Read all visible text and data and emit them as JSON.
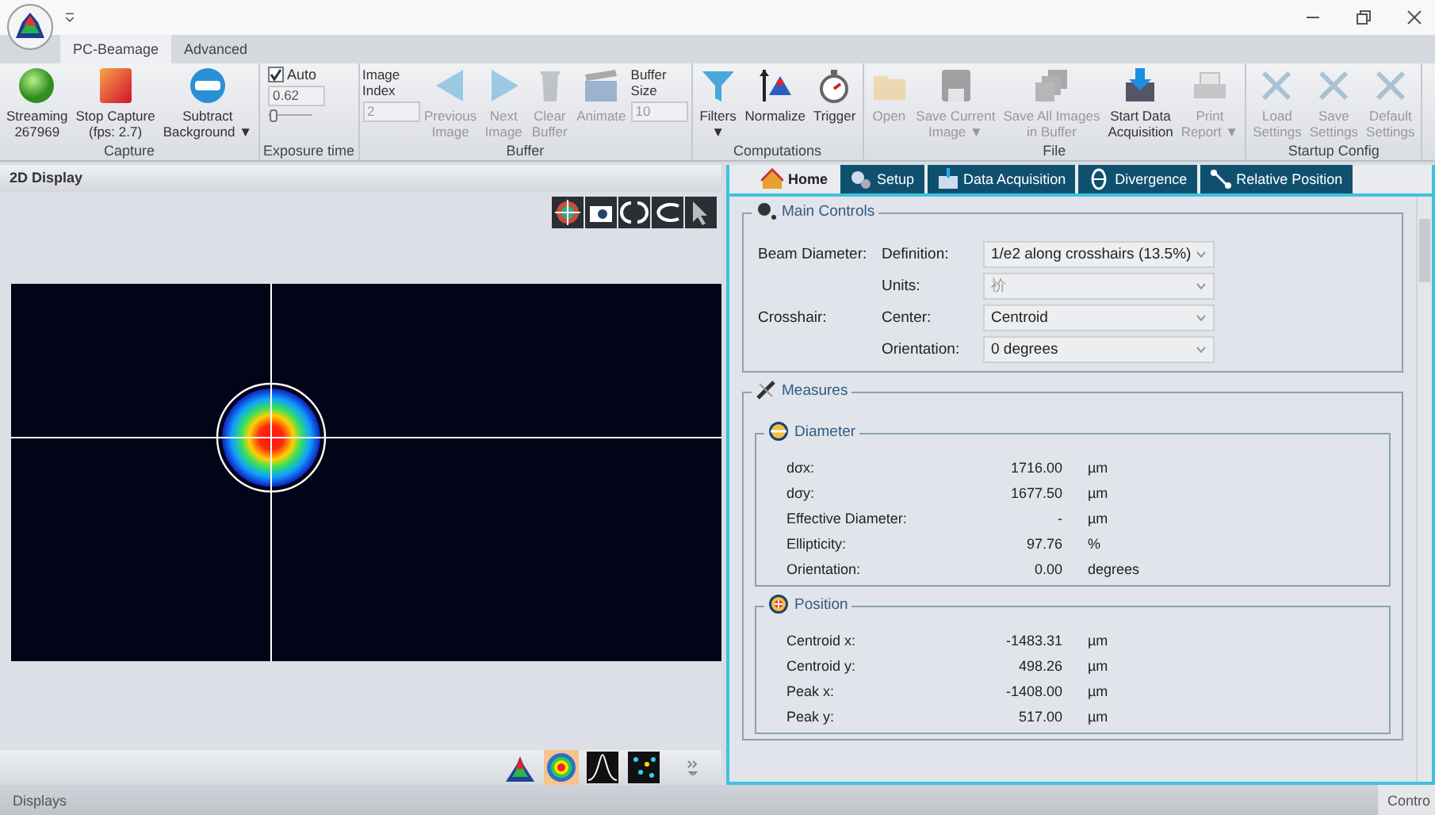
{
  "window": {
    "tabs": [
      {
        "label": "PC-Beamage",
        "selected": true
      },
      {
        "label": "Advanced",
        "selected": false
      }
    ]
  },
  "ribbon": {
    "groups": [
      {
        "label": "Capture",
        "items": [
          {
            "kind": "button",
            "label": "Streaming\n267969",
            "disabled": false
          },
          {
            "kind": "button",
            "label": "Stop Capture\n(fps: 2.7)",
            "disabled": false
          },
          {
            "kind": "button",
            "label": "Subtract\nBackground ▼",
            "disabled": false
          }
        ]
      },
      {
        "label": "Exposure time",
        "items": [
          {
            "kind": "checkbox",
            "label": "Auto",
            "checked": true
          },
          {
            "kind": "field",
            "value": "0.62",
            "disabled": false
          },
          {
            "kind": "slider",
            "level": 0.1
          }
        ]
      },
      {
        "label": "Buffer",
        "items": [
          {
            "kind": "labeled-field",
            "label": "Image\nIndex",
            "value": "2",
            "disabled": true
          },
          {
            "kind": "button",
            "label": "Previous\nImage",
            "disabled": true
          },
          {
            "kind": "button",
            "label": "Next\nImage",
            "disabled": true
          },
          {
            "kind": "button",
            "label": "Clear\nBuffer",
            "disabled": true
          },
          {
            "kind": "button",
            "label": "Animate",
            "disabled": true
          },
          {
            "kind": "labeled-field",
            "label": "Buffer\nSize",
            "value": "10",
            "disabled": true
          }
        ]
      },
      {
        "label": "Computations",
        "items": [
          {
            "kind": "button",
            "label": "Filters\n▼",
            "disabled": false
          },
          {
            "kind": "button",
            "label": "Normalize",
            "disabled": false
          },
          {
            "kind": "button",
            "label": "Trigger",
            "disabled": false
          }
        ]
      },
      {
        "label": "File",
        "items": [
          {
            "kind": "button",
            "label": "Open",
            "disabled": true
          },
          {
            "kind": "button",
            "label": "Save Current\nImage ▼",
            "disabled": true
          },
          {
            "kind": "button",
            "label": "Save All Images\nin Buffer",
            "disabled": true
          },
          {
            "kind": "button",
            "label": "Start Data\nAcquisition",
            "disabled": false
          },
          {
            "kind": "button",
            "label": "Print\nReport ▼",
            "disabled": true
          }
        ]
      },
      {
        "label": "Startup Config",
        "items": [
          {
            "kind": "button",
            "label": "Load\nSettings",
            "disabled": true
          },
          {
            "kind": "button",
            "label": "Save\nSettings",
            "disabled": true
          },
          {
            "kind": "button",
            "label": "Default\nSettings",
            "disabled": true
          }
        ]
      }
    ]
  },
  "display_panel": {
    "title": "2D Display",
    "view_buttons": [
      {
        "selected": false
      },
      {
        "selected": true
      },
      {
        "selected": false
      },
      {
        "selected": false
      }
    ]
  },
  "control_panel": {
    "tabs": [
      {
        "label": "Home",
        "selected": true
      },
      {
        "label": "Setup",
        "selected": false
      },
      {
        "label": "Data Acquisition",
        "selected": false
      },
      {
        "label": "Divergence",
        "selected": false
      },
      {
        "label": "Relative Position",
        "selected": false
      }
    ],
    "main_controls": {
      "title": "Main Controls",
      "rows": [
        {
          "group": "Beam Diameter:",
          "label": "Definition:",
          "value": "1/e2 along crosshairs (13.5%)",
          "disabled": false
        },
        {
          "label": "Units:",
          "value": "祄",
          "disabled": true
        },
        {
          "group": "Crosshair:",
          "label": "Center:",
          "value": "Centroid",
          "disabled": false
        },
        {
          "label": "Orientation:",
          "value": "0 degrees",
          "disabled": false
        }
      ]
    },
    "measures": {
      "title": "Measures",
      "sections": [
        {
          "title": "Diameter",
          "rows": [
            {
              "label": "dσx:",
              "value": "1716.00",
              "unit": "µm"
            },
            {
              "label": "dσy:",
              "value": "1677.50",
              "unit": "µm"
            },
            {
              "label": "Effective Diameter:",
              "value": "-",
              "unit": "µm"
            },
            {
              "label": "Ellipticity:",
              "value": "97.76",
              "unit": "%"
            },
            {
              "label": "Orientation:",
              "value": "0.00",
              "unit": "degrees"
            }
          ]
        },
        {
          "title": "Position",
          "rows": [
            {
              "label": "Centroid x:",
              "value": "-1483.31",
              "unit": "µm"
            },
            {
              "label": "Centroid y:",
              "value": "498.26",
              "unit": "µm"
            },
            {
              "label": "Peak x:",
              "value": "-1408.00",
              "unit": "µm"
            },
            {
              "label": "Peak y:",
              "value": "517.00",
              "unit": "µm"
            }
          ]
        }
      ]
    }
  },
  "status_bar": {
    "text": "Displays",
    "tab": "Contro"
  }
}
